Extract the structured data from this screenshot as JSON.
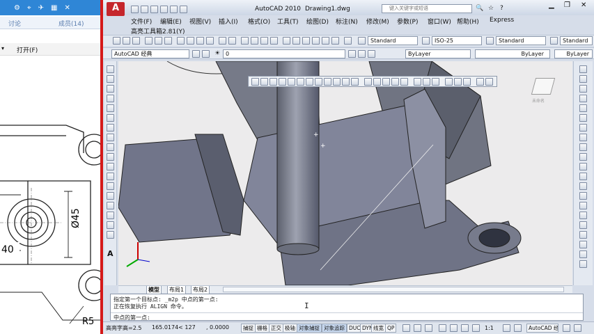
{
  "left_panel": {
    "tabs": [
      "讨论",
      "成员(14)"
    ],
    "open_label": "打开(F)",
    "dimensions": [
      "Ø45",
      "40",
      "R5"
    ]
  },
  "app": {
    "title": "AutoCAD 2010",
    "document": "Drawing1.dwg",
    "search_placeholder": "键入关键字或短语",
    "menu": [
      "文件(F)",
      "编辑(E)",
      "视图(V)",
      "插入(I)",
      "格式(O)",
      "工具(T)",
      "绘图(D)",
      "标注(N)",
      "修改(M)",
      "参数(P)",
      "窗口(W)",
      "帮助(H)",
      "Express"
    ],
    "submenu": "高亮工具箱2.81(Y)",
    "text_style": "Standard",
    "dim_style": "ISO-25",
    "table_style": "Standard",
    "workspace": "AutoCAD 经典",
    "layer": "0",
    "color": "ByLayer",
    "linetype": "ByLayer",
    "lineweight": "ByLayer",
    "viewcube_label": "未命名",
    "layout_tabs": [
      "模型",
      "布局1",
      "布局2"
    ],
    "command_lines": [
      "指定第一个目标点: _m2p 中点的第一点:",
      "正在恢复执行 ALIGN 命令。"
    ],
    "command_prompt": "中点的第一点:",
    "status_left": "高亮字高=2.5",
    "coords": "165.0174< 127      , 0.0000",
    "status_buttons": [
      "捕捉",
      "栅格",
      "正交",
      "极轴",
      "对象捕捉",
      "对象追踪",
      "DUCS",
      "DYN",
      "线宽",
      "QP"
    ],
    "annotation_scale": "1:1",
    "status_app": "AutoCAD 经"
  },
  "colors": {
    "titlebar_accent": "#2f86d6",
    "model_fill": "#7a7e8c",
    "viewport_bg": "#ecebec"
  }
}
